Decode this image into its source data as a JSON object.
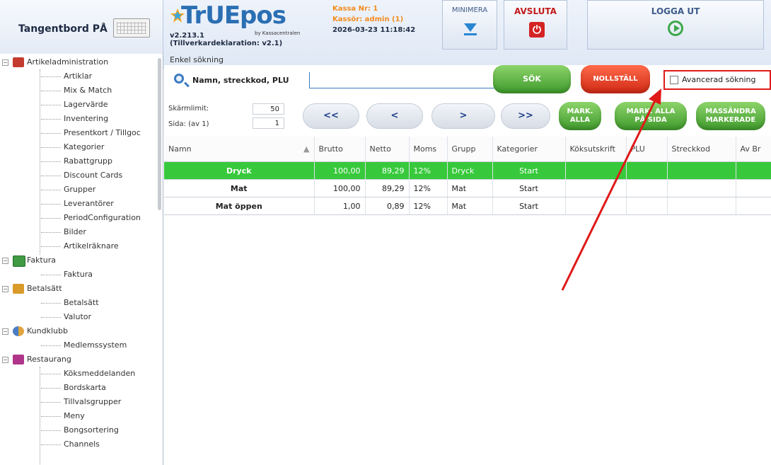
{
  "topbar": {
    "keyboard_toggle": "Tangentbord PÅ",
    "logo_text": "TrUEpos",
    "logo_sub": "by Kassacentralen",
    "version": "v2.213.1",
    "declaration": "(Tillverkardeklaration: v2.1)",
    "kassa_nr": "Kassa Nr: 1",
    "kassor": "Kassör: admin (1)",
    "datetime": "2026-03-23 11:18:42",
    "minimera": "MINIMERA",
    "avsluta": "AVSLUTA",
    "logga_ut": "LOGGA UT",
    "enkel_sokning": "Enkel sökning"
  },
  "sidebar": {
    "groups": [
      {
        "label": "Artikeladministration",
        "icon": "cart-icon",
        "items": [
          "Artiklar",
          "Mix & Match",
          "Lagervärde",
          "Inventering",
          "Presentkort / Tillgoc",
          "Kategorier",
          "Rabattgrupp",
          "Discount Cards",
          "Grupper",
          "Leverantörer",
          "PeriodConfiguration",
          "Bilder",
          "Artikelräknare"
        ]
      },
      {
        "label": "Faktura",
        "icon": "invoice-icon",
        "items": [
          "Faktura"
        ]
      },
      {
        "label": "Betalsätt",
        "icon": "wallet-icon",
        "items": [
          "Betalsätt",
          "Valutor"
        ]
      },
      {
        "label": "Kundklubb",
        "icon": "people-icon",
        "items": [
          "Medlemssystem"
        ]
      },
      {
        "label": "Restaurang",
        "icon": "restaurant-icon",
        "items": [
          "Köksmeddelanden",
          "Bordskarta",
          "Tillvalsgrupper",
          "Meny",
          "Bongsortering",
          "Channels"
        ]
      }
    ]
  },
  "search": {
    "label": "Namn, streckkod, PLU",
    "value": "",
    "sok": "SÖK",
    "nollstall": "NOLLSTÄLL",
    "advanced": "Avancerad sökning",
    "advanced_checked": false
  },
  "paging": {
    "limit_label": "Skärmlimit:",
    "limit_value": "50",
    "page_label": "Sida: (av 1)",
    "page_value": "1",
    "first": "<<",
    "prev": "<",
    "next": ">",
    "last": ">>",
    "mark_all_1": "MARK.",
    "mark_all_2": "ALLA",
    "mark_page_1": "MARK. ALLA",
    "mark_page_2": "PÅ SIDA",
    "mass_1": "MASSÄNDRA",
    "mass_2": "MARKERADE"
  },
  "table": {
    "columns": [
      "Namn",
      "Brutto",
      "Netto",
      "Moms",
      "Grupp",
      "Kategorier",
      "Köksutskrift",
      "PLU",
      "Streckkod",
      "Av Br"
    ],
    "rows": [
      {
        "name": "Dryck",
        "brutto": "100,00",
        "netto": "89,29",
        "moms": "12%",
        "grupp": "Dryck",
        "kategorier": "Start",
        "selected": true
      },
      {
        "name": "Mat",
        "brutto": "100,00",
        "netto": "89,29",
        "moms": "12%",
        "grupp": "Mat",
        "kategorier": "Start",
        "selected": false
      },
      {
        "name": "Mat öppen",
        "brutto": "1,00",
        "netto": "0,89",
        "moms": "12%",
        "grupp": "Mat",
        "kategorier": "Start",
        "selected": false
      }
    ]
  },
  "colors": {
    "selected_row": "#37c93b",
    "annotation": "#e01919",
    "accent": "#3c7bc1",
    "button_green": "#4fae37",
    "button_red": "#e0381e"
  }
}
